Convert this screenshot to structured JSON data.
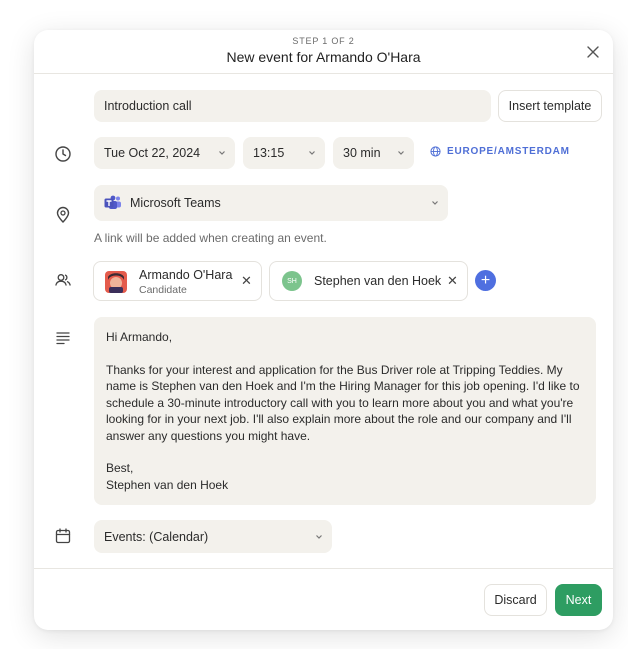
{
  "header": {
    "step": "STEP 1 OF 2",
    "title": "New event for Armando O'Hara"
  },
  "event": {
    "name": "Introduction call",
    "insert_template_label": "Insert template"
  },
  "schedule": {
    "date": "Tue Oct 22, 2024",
    "time": "13:15",
    "duration": "30 min",
    "timezone": "EUROPE/AMSTERDAM"
  },
  "location": {
    "value": "Microsoft Teams",
    "hint": "A link will be added when creating an event."
  },
  "attendees": [
    {
      "name": "Armando O'Hara",
      "role": "Candidate"
    },
    {
      "name": "Stephen van den Hoek",
      "initials": "SH"
    }
  ],
  "message": {
    "greeting": "Hi Armando,",
    "body": "Thanks for your interest and application for the Bus Driver role at Tripping Teddies. My name is Stephen van den Hoek and I'm the Hiring Manager for this job opening. I'd like to schedule a 30-minute introductory call with you to learn more about you and what you're looking for in your next job. I'll also explain more about the role and our company and I'll answer any questions you might have.",
    "signoff_1": "Best,",
    "signoff_2": "Stephen van den Hoek"
  },
  "calendar": {
    "value": "Events: (Calendar)"
  },
  "footer": {
    "discard_label": "Discard",
    "next_label": "Next"
  },
  "colors": {
    "accent_blue": "#4f6fe0",
    "primary_green": "#2e9d62",
    "field_bg": "#f3f1ec"
  }
}
